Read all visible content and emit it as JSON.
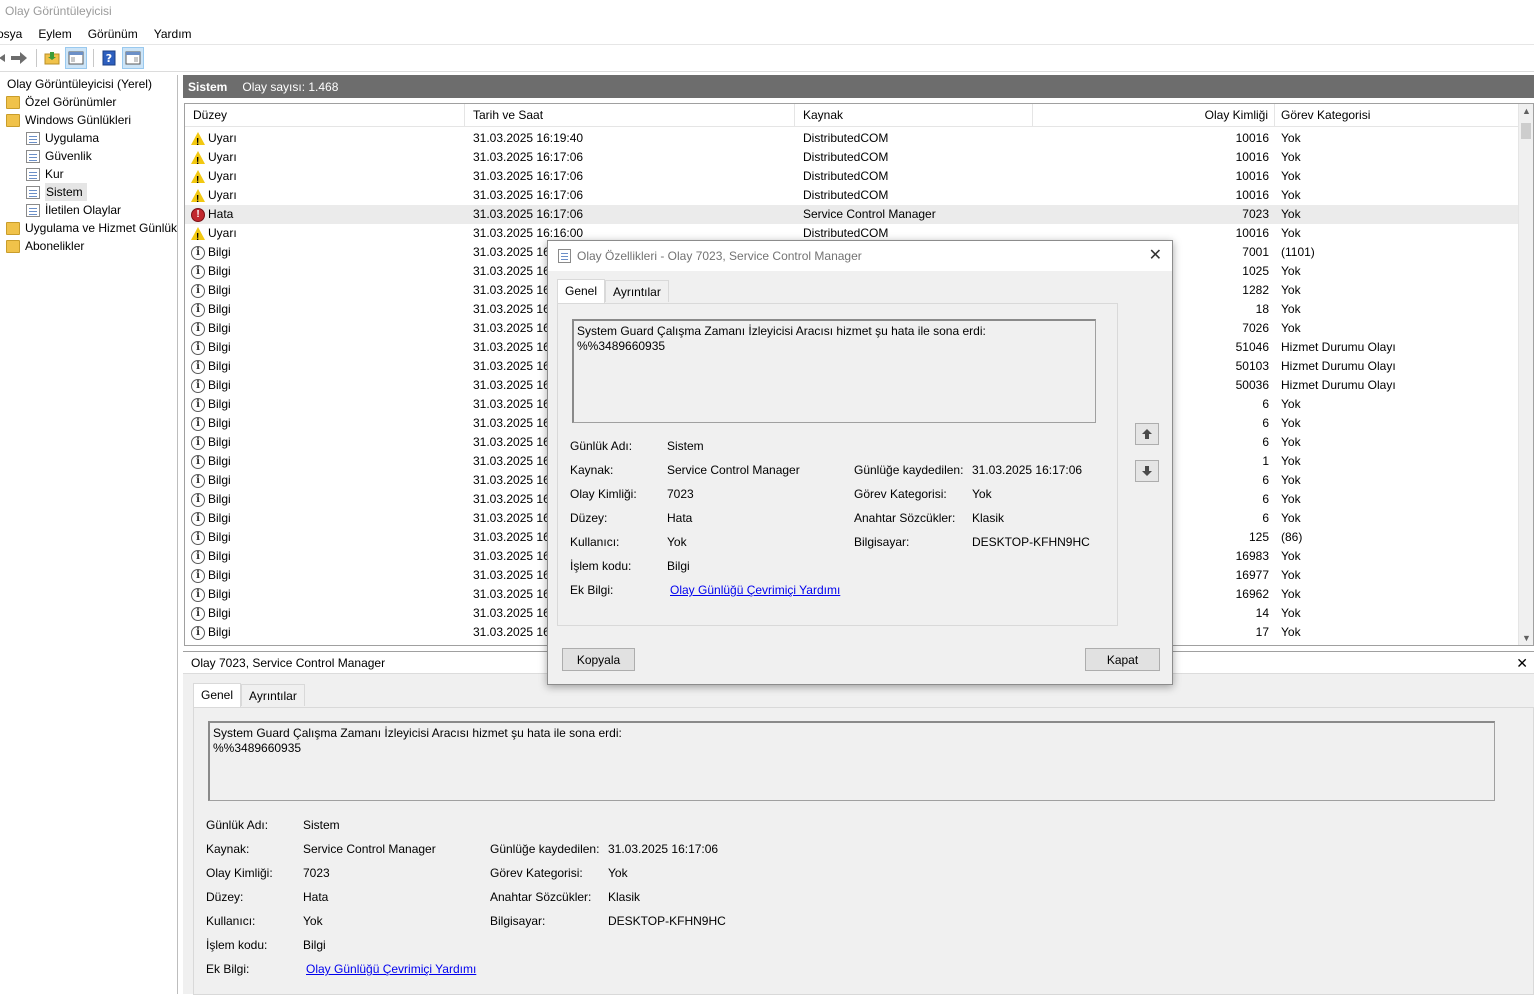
{
  "window": {
    "title": "Olay Görüntüleyicisi"
  },
  "menu": {
    "items": [
      "osya",
      "Eylem",
      "Görünüm",
      "Yardım"
    ]
  },
  "toolbar": {
    "icons": [
      "back-arrow-icon",
      "forward-arrow-icon",
      "open-folder-icon",
      "console-tree-icon",
      "help-icon",
      "action-pane-icon"
    ]
  },
  "tree": {
    "root": "Olay Görüntüleyicisi (Yerel)",
    "custom_views": "Özel Görünümler",
    "windows_logs": "Windows Günlükleri",
    "logs": [
      "Uygulama",
      "Güvenlik",
      "Kur",
      "Sistem",
      "İletilen Olaylar"
    ],
    "app_services": "Uygulama ve Hizmet Günlük",
    "subscriptions": "Abonelikler"
  },
  "main": {
    "log_name": "Sistem",
    "event_count": "Olay sayısı: 1.468",
    "columns": [
      "Düzey",
      "Tarih ve Saat",
      "Kaynak",
      "Olay Kimliği",
      "Görev Kategorisi"
    ],
    "rows": [
      {
        "level": "Uyarı",
        "kind": "warn",
        "date": "31.03.2025 16:19:40",
        "source": "DistributedCOM",
        "id": "10016",
        "cat": "Yok"
      },
      {
        "level": "Uyarı",
        "kind": "warn",
        "date": "31.03.2025 16:17:06",
        "source": "DistributedCOM",
        "id": "10016",
        "cat": "Yok"
      },
      {
        "level": "Uyarı",
        "kind": "warn",
        "date": "31.03.2025 16:17:06",
        "source": "DistributedCOM",
        "id": "10016",
        "cat": "Yok"
      },
      {
        "level": "Uyarı",
        "kind": "warn",
        "date": "31.03.2025 16:17:06",
        "source": "DistributedCOM",
        "id": "10016",
        "cat": "Yok"
      },
      {
        "level": "Hata",
        "kind": "err",
        "date": "31.03.2025 16:17:06",
        "source": "Service Control Manager",
        "id": "7023",
        "cat": "Yok",
        "selected": true
      },
      {
        "level": "Uyarı",
        "kind": "warn",
        "date": "31.03.2025 16:16:00",
        "source": "DistributedCOM",
        "id": "10016",
        "cat": "Yok"
      },
      {
        "level": "Bilgi",
        "kind": "info",
        "date": "31.03.2025 16:1",
        "source": "",
        "id": "7001",
        "cat": "(1101)"
      },
      {
        "level": "Bilgi",
        "kind": "info",
        "date": "31.03.2025 16:1",
        "source": "",
        "id": "1025",
        "cat": "Yok"
      },
      {
        "level": "Bilgi",
        "kind": "info",
        "date": "31.03.2025 16:1",
        "source": "",
        "id": "1282",
        "cat": "Yok"
      },
      {
        "level": "Bilgi",
        "kind": "info",
        "date": "31.03.2025 16:1",
        "source": "",
        "id": "18",
        "cat": "Yok"
      },
      {
        "level": "Bilgi",
        "kind": "info",
        "date": "31.03.2025 16:1",
        "source": "",
        "id": "7026",
        "cat": "Yok"
      },
      {
        "level": "Bilgi",
        "kind": "info",
        "date": "31.03.2025 16:1",
        "source": "",
        "id": "51046",
        "cat": "Hizmet Durumu Olayı"
      },
      {
        "level": "Bilgi",
        "kind": "info",
        "date": "31.03.2025 16:1",
        "source": "",
        "id": "50103",
        "cat": "Hizmet Durumu Olayı"
      },
      {
        "level": "Bilgi",
        "kind": "info",
        "date": "31.03.2025 16:1",
        "source": "",
        "id": "50036",
        "cat": "Hizmet Durumu Olayı"
      },
      {
        "level": "Bilgi",
        "kind": "info",
        "date": "31.03.2025 16:1",
        "source": "",
        "id": "6",
        "cat": "Yok"
      },
      {
        "level": "Bilgi",
        "kind": "info",
        "date": "31.03.2025 16:1",
        "source": "",
        "id": "6",
        "cat": "Yok"
      },
      {
        "level": "Bilgi",
        "kind": "info",
        "date": "31.03.2025 16:1",
        "source": "",
        "id": "6",
        "cat": "Yok"
      },
      {
        "level": "Bilgi",
        "kind": "info",
        "date": "31.03.2025 16:1",
        "source": "",
        "id": "1",
        "cat": "Yok"
      },
      {
        "level": "Bilgi",
        "kind": "info",
        "date": "31.03.2025 16:1",
        "source": "",
        "id": "6",
        "cat": "Yok"
      },
      {
        "level": "Bilgi",
        "kind": "info",
        "date": "31.03.2025 16:1",
        "source": "",
        "id": "6",
        "cat": "Yok"
      },
      {
        "level": "Bilgi",
        "kind": "info",
        "date": "31.03.2025 16:1",
        "source": "",
        "id": "6",
        "cat": "Yok"
      },
      {
        "level": "Bilgi",
        "kind": "info",
        "date": "31.03.2025 16:1",
        "source": "",
        "id": "125",
        "cat": "(86)"
      },
      {
        "level": "Bilgi",
        "kind": "info",
        "date": "31.03.2025 16:1",
        "source": "",
        "id": "16983",
        "cat": "Yok"
      },
      {
        "level": "Bilgi",
        "kind": "info",
        "date": "31.03.2025 16:1",
        "source": "",
        "id": "16977",
        "cat": "Yok"
      },
      {
        "level": "Bilgi",
        "kind": "info",
        "date": "31.03.2025 16:1",
        "source": "",
        "id": "16962",
        "cat": "Yok"
      },
      {
        "level": "Bilgi",
        "kind": "info",
        "date": "31.03.2025 16:1",
        "source": "",
        "id": "14",
        "cat": "Yok"
      },
      {
        "level": "Bilgi",
        "kind": "info",
        "date": "31.03.2025 16:1",
        "source": "",
        "id": "17",
        "cat": "Yok"
      }
    ]
  },
  "event": {
    "description": "System Guard Çalışma Zamanı İzleyicisi Aracısı hizmet şu hata ile sona erdi: \n%%3489660935",
    "labels": {
      "log_name": "Günlük Adı:",
      "source": "Kaynak:",
      "event_id": "Olay Kimliği:",
      "level": "Düzey:",
      "user": "Kullanıcı:",
      "opcode": "İşlem kodu:",
      "more_info": "Ek Bilgi:",
      "logged": "Günlüğe kaydedilen:",
      "task_category": "Görev Kategorisi:",
      "keywords": "Anahtar Sözcükler:",
      "computer": "Bilgisayar:"
    },
    "values": {
      "log_name": "Sistem",
      "source": "Service Control Manager",
      "event_id": "7023",
      "level": "Hata",
      "user": "Yok",
      "opcode": "Bilgi",
      "more_info_link": "Olay Günlüğü Çevrimiçi Yardımı",
      "logged": "31.03.2025 16:17:06",
      "task_category": "Yok",
      "keywords": "Klasik",
      "computer": "DESKTOP-KFHN9HC"
    }
  },
  "preview": {
    "title": "Olay 7023, Service Control Manager"
  },
  "tabs": {
    "general": "Genel",
    "details": "Ayrıntılar"
  },
  "dialog": {
    "title": "Olay Özellikleri - Olay 7023, Service Control Manager",
    "copy_button": "Kopyala",
    "close_button": "Kapat"
  }
}
